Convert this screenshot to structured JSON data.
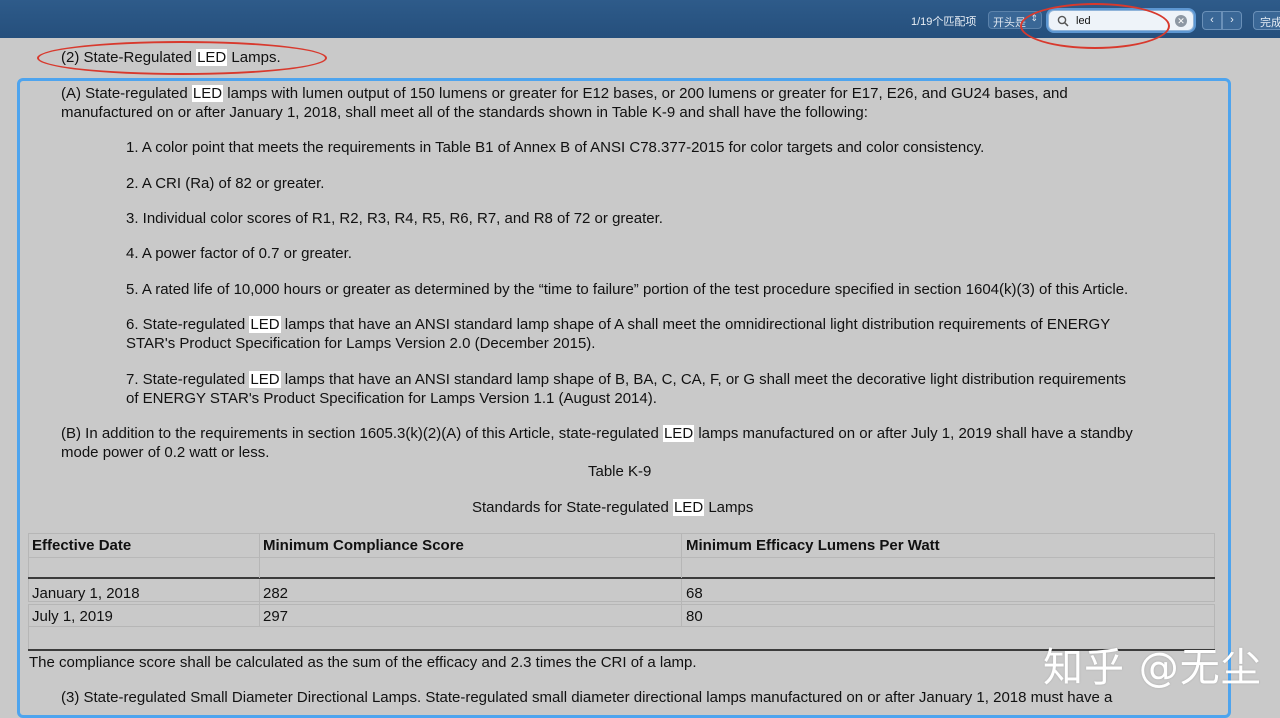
{
  "findbar": {
    "match_count": "1/19个匹配项",
    "match_mode": "开头是",
    "search_value": "led",
    "prev_label": "‹",
    "next_label": "›",
    "done_label": "完成"
  },
  "doc": {
    "section2_before": "(2) State-Regulated ",
    "section2_hl": "LED",
    "section2_after": " Lamps.",
    "para_a_line1_before": "(A) State-regulated ",
    "para_a_line1_hl": "LED",
    "para_a_line1_after": " lamps with lumen output of 150 lumens or greater for E12 bases, or 200 lumens or greater for E17, E26, and GU24 bases, and",
    "para_a_line2": "manufactured on or after January 1, 2018, shall meet all of the standards shown in Table K-9 and shall have the following:",
    "item1": "1. A color point that meets the requirements in Table B1 of Annex B of ANSI C78.377-2015 for color targets and color consistency.",
    "item2": "2. A CRI (Ra) of 82 or greater.",
    "item3": "3. Individual color scores of R1, R2, R3, R4, R5, R6, R7, and R8 of 72 or greater.",
    "item4": "4. A power factor of 0.7 or greater.",
    "item5": "5. A rated life of 10,000 hours or greater as determined by the “time to failure” portion of the test procedure specified in section 1604(k)(3) of this Article.",
    "item6_line1_before": "6. State-regulated ",
    "item6_line1_hl": "LED",
    "item6_line1_after": " lamps that have an ANSI standard lamp shape of A shall meet the omnidirectional light distribution requirements of ENERGY",
    "item6_line2": "STAR's Product Specification for Lamps Version 2.0 (December 2015).",
    "item7_line1_before": "7. State-regulated ",
    "item7_line1_hl": "LED",
    "item7_line1_after": " lamps that have an ANSI standard lamp shape of B, BA, C, CA, F, or G shall meet the decorative light distribution requirements",
    "item7_line2": "of ENERGY STAR's Product Specification for Lamps Version 1.1 (August 2014).",
    "para_b_line1_before": "(B) In addition to the requirements in section 1605.3(k)(2)(A) of this Article, state-regulated ",
    "para_b_line1_hl": "LED",
    "para_b_line1_after": " lamps manufactured on or after July 1, 2019 shall have a standby",
    "para_b_line2": "mode power of 0.2 watt or less.",
    "table_label": "Table K-9",
    "table_caption_before": "Standards for State-regulated ",
    "table_caption_hl": "LED",
    "table_caption_after": " Lamps",
    "table": {
      "headers": [
        "Effective Date",
        "Minimum Compliance Score",
        "Minimum Efficacy Lumens Per Watt"
      ],
      "rows": [
        [
          "January 1, 2018",
          "282",
          "68"
        ],
        [
          "July 1, 2019",
          "297",
          "80"
        ]
      ]
    },
    "compliance_note": "The compliance score shall be calculated as the sum of the efficacy and 2.3 times the CRI of a lamp.",
    "section3": "(3) State-regulated Small Diameter Directional Lamps. State-regulated small diameter directional lamps manufactured on or after January 1, 2018 must have a"
  },
  "watermark": "知乎 @无尘",
  "colors": {
    "annotation_red": "#d8392d",
    "selection_blue": "#4ea4ee",
    "findbar_blue": "#2b5786",
    "page_gray": "#c9c9c9"
  }
}
